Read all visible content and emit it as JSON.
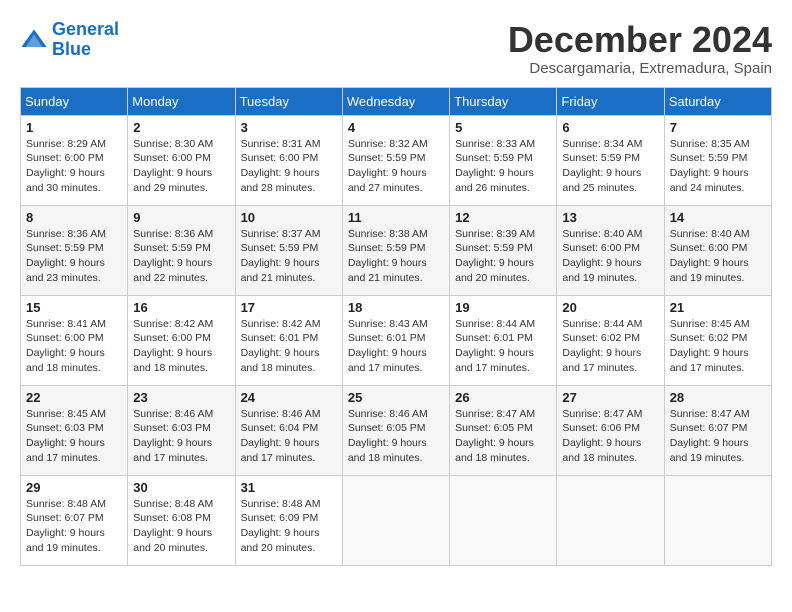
{
  "header": {
    "logo_line1": "General",
    "logo_line2": "Blue",
    "month_title": "December 2024",
    "subtitle": "Descargamaria, Extremadura, Spain"
  },
  "days_of_week": [
    "Sunday",
    "Monday",
    "Tuesday",
    "Wednesday",
    "Thursday",
    "Friday",
    "Saturday"
  ],
  "weeks": [
    [
      {
        "day": "1",
        "sunrise": "8:29 AM",
        "sunset": "6:00 PM",
        "daylight": "9 hours and 30 minutes."
      },
      {
        "day": "2",
        "sunrise": "8:30 AM",
        "sunset": "6:00 PM",
        "daylight": "9 hours and 29 minutes."
      },
      {
        "day": "3",
        "sunrise": "8:31 AM",
        "sunset": "6:00 PM",
        "daylight": "9 hours and 28 minutes."
      },
      {
        "day": "4",
        "sunrise": "8:32 AM",
        "sunset": "5:59 PM",
        "daylight": "9 hours and 27 minutes."
      },
      {
        "day": "5",
        "sunrise": "8:33 AM",
        "sunset": "5:59 PM",
        "daylight": "9 hours and 26 minutes."
      },
      {
        "day": "6",
        "sunrise": "8:34 AM",
        "sunset": "5:59 PM",
        "daylight": "9 hours and 25 minutes."
      },
      {
        "day": "7",
        "sunrise": "8:35 AM",
        "sunset": "5:59 PM",
        "daylight": "9 hours and 24 minutes."
      }
    ],
    [
      {
        "day": "8",
        "sunrise": "8:36 AM",
        "sunset": "5:59 PM",
        "daylight": "9 hours and 23 minutes."
      },
      {
        "day": "9",
        "sunrise": "8:36 AM",
        "sunset": "5:59 PM",
        "daylight": "9 hours and 22 minutes."
      },
      {
        "day": "10",
        "sunrise": "8:37 AM",
        "sunset": "5:59 PM",
        "daylight": "9 hours and 21 minutes."
      },
      {
        "day": "11",
        "sunrise": "8:38 AM",
        "sunset": "5:59 PM",
        "daylight": "9 hours and 21 minutes."
      },
      {
        "day": "12",
        "sunrise": "8:39 AM",
        "sunset": "5:59 PM",
        "daylight": "9 hours and 20 minutes."
      },
      {
        "day": "13",
        "sunrise": "8:40 AM",
        "sunset": "6:00 PM",
        "daylight": "9 hours and 19 minutes."
      },
      {
        "day": "14",
        "sunrise": "8:40 AM",
        "sunset": "6:00 PM",
        "daylight": "9 hours and 19 minutes."
      }
    ],
    [
      {
        "day": "15",
        "sunrise": "8:41 AM",
        "sunset": "6:00 PM",
        "daylight": "9 hours and 18 minutes."
      },
      {
        "day": "16",
        "sunrise": "8:42 AM",
        "sunset": "6:00 PM",
        "daylight": "9 hours and 18 minutes."
      },
      {
        "day": "17",
        "sunrise": "8:42 AM",
        "sunset": "6:01 PM",
        "daylight": "9 hours and 18 minutes."
      },
      {
        "day": "18",
        "sunrise": "8:43 AM",
        "sunset": "6:01 PM",
        "daylight": "9 hours and 17 minutes."
      },
      {
        "day": "19",
        "sunrise": "8:44 AM",
        "sunset": "6:01 PM",
        "daylight": "9 hours and 17 minutes."
      },
      {
        "day": "20",
        "sunrise": "8:44 AM",
        "sunset": "6:02 PM",
        "daylight": "9 hours and 17 minutes."
      },
      {
        "day": "21",
        "sunrise": "8:45 AM",
        "sunset": "6:02 PM",
        "daylight": "9 hours and 17 minutes."
      }
    ],
    [
      {
        "day": "22",
        "sunrise": "8:45 AM",
        "sunset": "6:03 PM",
        "daylight": "9 hours and 17 minutes."
      },
      {
        "day": "23",
        "sunrise": "8:46 AM",
        "sunset": "6:03 PM",
        "daylight": "9 hours and 17 minutes."
      },
      {
        "day": "24",
        "sunrise": "8:46 AM",
        "sunset": "6:04 PM",
        "daylight": "9 hours and 17 minutes."
      },
      {
        "day": "25",
        "sunrise": "8:46 AM",
        "sunset": "6:05 PM",
        "daylight": "9 hours and 18 minutes."
      },
      {
        "day": "26",
        "sunrise": "8:47 AM",
        "sunset": "6:05 PM",
        "daylight": "9 hours and 18 minutes."
      },
      {
        "day": "27",
        "sunrise": "8:47 AM",
        "sunset": "6:06 PM",
        "daylight": "9 hours and 18 minutes."
      },
      {
        "day": "28",
        "sunrise": "8:47 AM",
        "sunset": "6:07 PM",
        "daylight": "9 hours and 19 minutes."
      }
    ],
    [
      {
        "day": "29",
        "sunrise": "8:48 AM",
        "sunset": "6:07 PM",
        "daylight": "9 hours and 19 minutes."
      },
      {
        "day": "30",
        "sunrise": "8:48 AM",
        "sunset": "6:08 PM",
        "daylight": "9 hours and 20 minutes."
      },
      {
        "day": "31",
        "sunrise": "8:48 AM",
        "sunset": "6:09 PM",
        "daylight": "9 hours and 20 minutes."
      },
      null,
      null,
      null,
      null
    ]
  ]
}
